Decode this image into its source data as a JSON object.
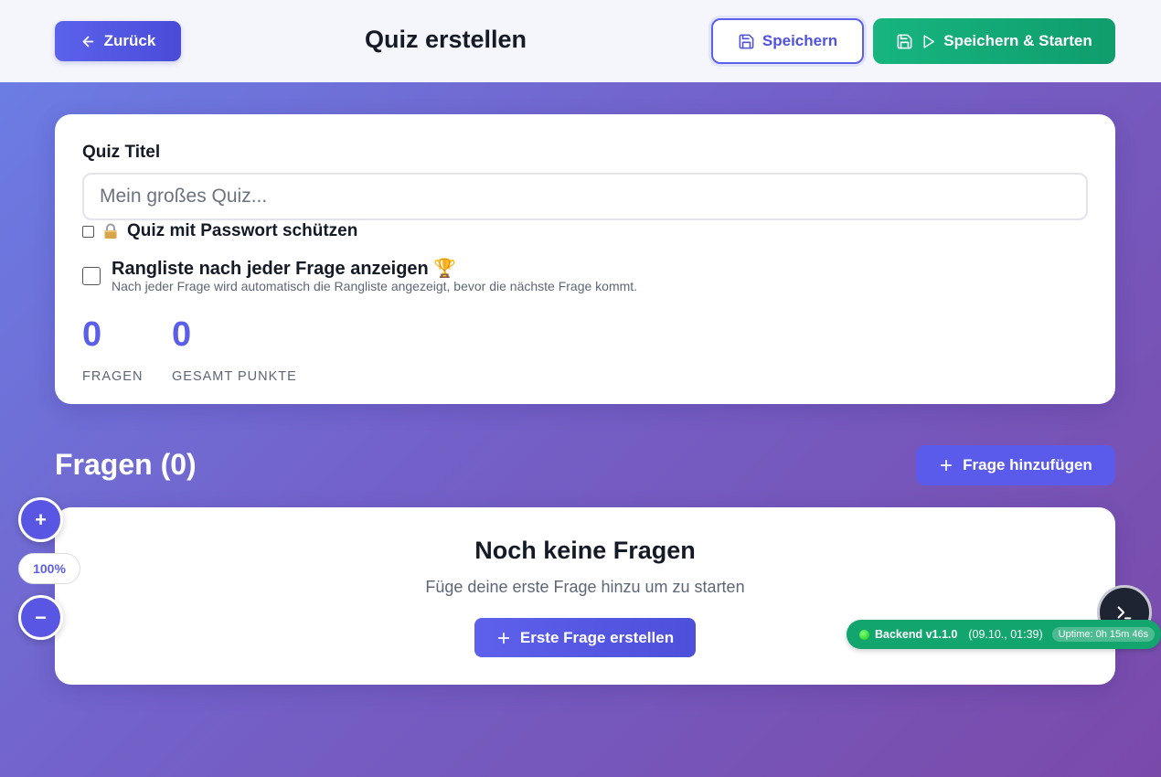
{
  "header": {
    "back_label": "Zurück",
    "title": "Quiz erstellen",
    "save_label": "Speichern",
    "save_start_label": "Speichern & Starten"
  },
  "settings": {
    "title_label": "Quiz Titel",
    "title_placeholder": "Mein großes Quiz...",
    "title_value": "",
    "password_label": "Quiz mit Passwort schützen",
    "password_checked": false,
    "leaderboard_label": "Rangliste nach jeder Frage anzeigen 🏆",
    "leaderboard_desc": "Nach jeder Frage wird automatisch die Rangliste angezeigt, bevor die nächste Frage kommt.",
    "leaderboard_checked": false
  },
  "stats": {
    "questions_count": "0",
    "questions_label": "FRAGEN",
    "points_count": "0",
    "points_label": "GESAMT PUNKTE"
  },
  "questions": {
    "heading": "Fragen (0)",
    "add_label": "Frage hinzufügen",
    "empty_title": "Noch keine Fragen",
    "empty_sub": "Füge deine erste Frage hinzu um zu starten",
    "first_label": "Erste Frage erstellen"
  },
  "zoom": {
    "plus": "+",
    "level": "100%",
    "minus": "−"
  },
  "backend": {
    "name": "Backend v1.1.0",
    "time": "(09.10., 01:39)",
    "uptime": "Uptime: 0h 15m 46s"
  },
  "colors": {
    "accent": "#5b5ee8",
    "success": "#12a56e",
    "background_start": "#6a7fe6",
    "background_end": "#7a4aa9"
  }
}
